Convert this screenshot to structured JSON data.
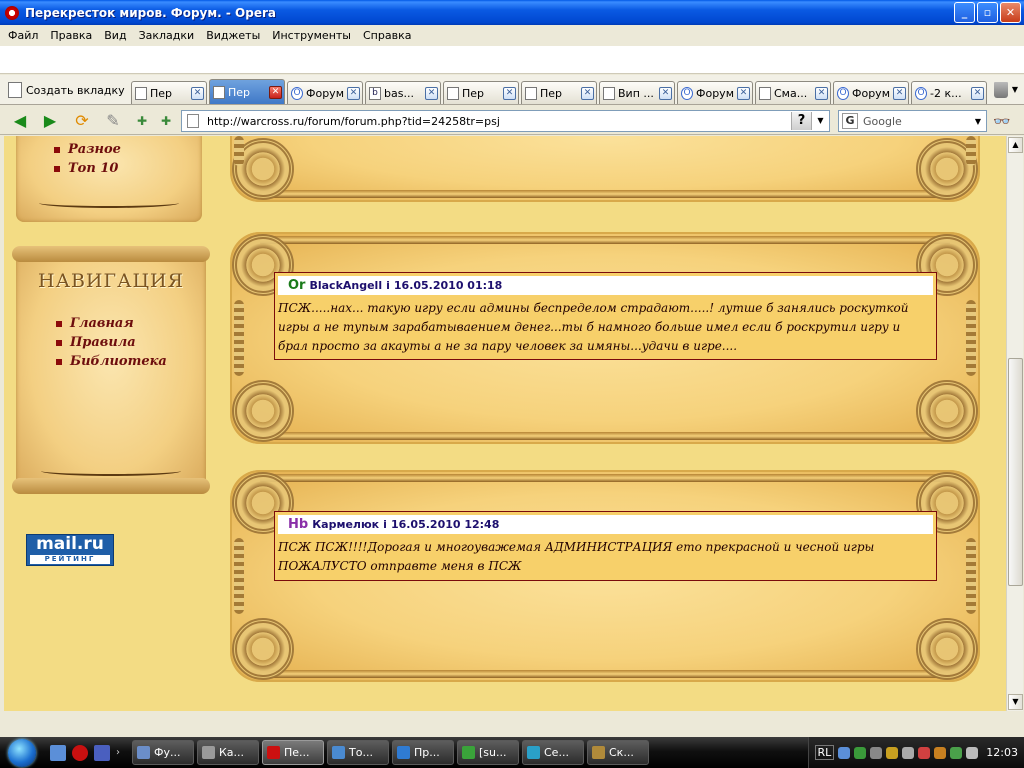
{
  "window": {
    "title": "Перекресток миров. Форум. - Opera"
  },
  "menu": [
    "Файл",
    "Правка",
    "Вид",
    "Закладки",
    "Виджеты",
    "Инструменты",
    "Справка"
  ],
  "tabs": {
    "new_tab_label": "Создать вкладку",
    "items": [
      {
        "label": "Пер",
        "icon": "page",
        "active": false
      },
      {
        "label": "Пер",
        "icon": "page",
        "active": true
      },
      {
        "label": "Форум",
        "icon": "opera",
        "active": false
      },
      {
        "label": "bas...",
        "icon": "b",
        "active": false
      },
      {
        "label": "Пер",
        "icon": "page",
        "active": false
      },
      {
        "label": "Пер",
        "icon": "page",
        "active": false
      },
      {
        "label": "Вип ...",
        "icon": "page",
        "active": false
      },
      {
        "label": "Форум",
        "icon": "opera",
        "active": false
      },
      {
        "label": "Сма...",
        "icon": "page",
        "active": false
      },
      {
        "label": "Форум",
        "icon": "opera",
        "active": false
      },
      {
        "label": "-2 к...",
        "icon": "opera",
        "active": false
      }
    ]
  },
  "address": {
    "url": "http://warcross.ru/forum/forum.php?tid=24258tr=psj",
    "help": "?"
  },
  "search": {
    "engine_icon": "G",
    "placeholder": "Google"
  },
  "sidebar": {
    "top_menu": [
      "Разное",
      "Топ 10"
    ],
    "nav_heading": "НАВИГАЦИЯ",
    "nav_items": [
      "Главная",
      "Правила",
      "Библиотека"
    ],
    "counter": {
      "brand": "mail.ru",
      "sub": "РЕЙТИНГ"
    }
  },
  "posts": [
    {
      "rank": "Or",
      "rank_color": "#1a7a1a",
      "author": "BlackAngell",
      "sep": "i",
      "date": "16.05.2010 01:18",
      "body": "ПСЖ.....нах... такую игру если админы беспределом страдают.....! лутше б занялись роскуткой игры а не тупым зарабатываением денег...ты б намного больше имел если б роскрутил игру и брал просто за акауты а не за пару человек за имяны...удачи в игре...."
    },
    {
      "rank": "Hb",
      "rank_color": "#8a2fa8",
      "author": "Кармелюк",
      "sep": "i",
      "date": "16.05.2010 12:48",
      "body": "ПСЖ ПСЖ!!!!Дорогая и многоуважемая АДМИНИСТРАЦИЯ ето прекрасной и чесной игры ПОЖАЛУСТО отправте меня в ПСЖ"
    }
  ],
  "taskbar": {
    "items": [
      {
        "label": "Фу...",
        "color": "#6b8ec9",
        "active": false
      },
      {
        "label": "Ка...",
        "color": "#9a9a9a",
        "active": false
      },
      {
        "label": "Пе...",
        "color": "#cc1010",
        "active": true
      },
      {
        "label": "То...",
        "color": "#4a8ad0",
        "active": false
      },
      {
        "label": "Пр...",
        "color": "#2f7bd3",
        "active": false
      },
      {
        "label": "[su...",
        "color": "#3aa33a",
        "active": false
      },
      {
        "label": "Се...",
        "color": "#2aa0c8",
        "active": false
      },
      {
        "label": "Ск...",
        "color": "#b08a3a",
        "active": false
      }
    ],
    "lang": "RL",
    "clock": "12:03"
  }
}
